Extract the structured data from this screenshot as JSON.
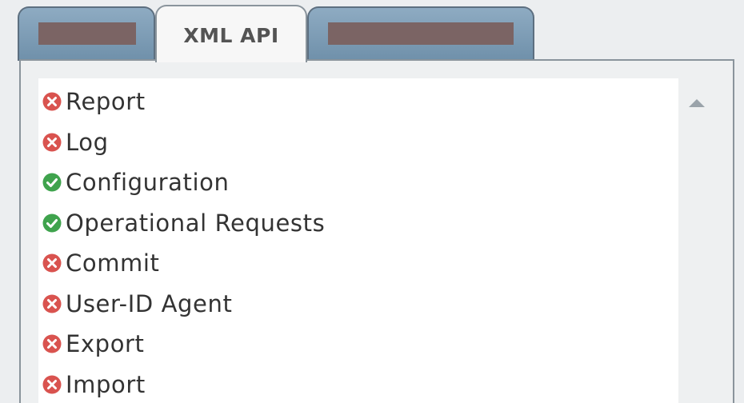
{
  "tabs": [
    {
      "label": "",
      "redacted": true,
      "active": false
    },
    {
      "label": "XML API",
      "redacted": false,
      "active": true
    },
    {
      "label": "",
      "redacted": true,
      "active": false
    }
  ],
  "permissions": {
    "items": [
      {
        "label": "Report",
        "status": "disabled",
        "icon": "x-circle-icon"
      },
      {
        "label": "Log",
        "status": "disabled",
        "icon": "x-circle-icon"
      },
      {
        "label": "Configuration",
        "status": "enabled",
        "icon": "check-circle-icon"
      },
      {
        "label": "Operational Requests",
        "status": "enabled",
        "icon": "check-circle-icon"
      },
      {
        "label": "Commit",
        "status": "disabled",
        "icon": "x-circle-icon"
      },
      {
        "label": "User-ID Agent",
        "status": "disabled",
        "icon": "x-circle-icon"
      },
      {
        "label": "Export",
        "status": "disabled",
        "icon": "x-circle-icon"
      },
      {
        "label": "Import",
        "status": "disabled",
        "icon": "x-circle-icon"
      }
    ]
  },
  "colors": {
    "disabled": "#d9534f",
    "enabled": "#3fa34d",
    "tab_inactive": "#7d9ab2",
    "redaction": "#7b6464"
  }
}
